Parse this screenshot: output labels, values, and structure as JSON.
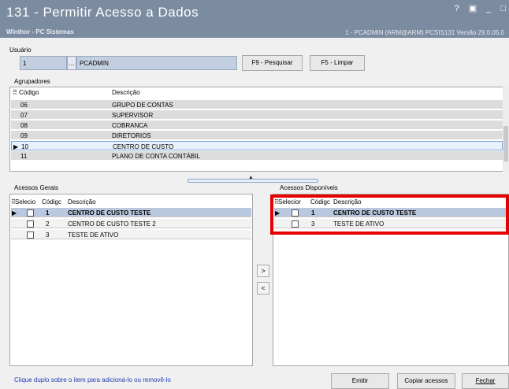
{
  "window": {
    "title": "131 - Permitir Acesso a Dados",
    "subtitle": "Winthor - PC Sistemas",
    "info": "1 - PCADMIN (ARM@ARM)  PCSIS131  Versão  29.0.05.0",
    "controls": [
      "?",
      "▣",
      "_",
      "□"
    ]
  },
  "user": {
    "label": "Usuário",
    "id": "1",
    "dots": "...",
    "name": "PCADMIN"
  },
  "buttons": {
    "search": "F9 - Pesquisar",
    "clear": "F5 - Limpar",
    "add": ">",
    "remove": "<",
    "emit": "Emitir",
    "copy": "Copiar acessos",
    "close": "Fechar"
  },
  "agrupadores": {
    "label": "Agrupadores",
    "headers": {
      "code": "Código",
      "desc": "Descrição"
    },
    "rows": [
      {
        "code": "06",
        "desc": "GRUPO DE CONTAS"
      },
      {
        "code": "07",
        "desc": "SUPERVISOR"
      },
      {
        "code": "08",
        "desc": "COBRANCA"
      },
      {
        "code": "09",
        "desc": "DIRETORIOS"
      },
      {
        "code": "10",
        "desc": "CENTRO DE CUSTO"
      },
      {
        "code": "11",
        "desc": "PLANO DE CONTA CONTÁBIL"
      }
    ]
  },
  "acessos_gerais": {
    "label": "Acessos Gerais",
    "headers": {
      "sel": "Selecio",
      "code": "Códigc",
      "desc": "Descrição"
    },
    "rows": [
      {
        "code": "1",
        "desc": "CENTRO DE CUSTO TESTE"
      },
      {
        "code": "2",
        "desc": "CENTRO DE CUSTO TESTE 2"
      },
      {
        "code": "3",
        "desc": "TESTE DE ATIVO"
      }
    ]
  },
  "acessos_disponiveis": {
    "label": "Acessos Disponíveis",
    "headers": {
      "sel": "Selecior",
      "code": "Códigc",
      "desc": "Descrição"
    },
    "rows": [
      {
        "code": "1",
        "desc": "CENTRO DE CUSTO TESTE"
      },
      {
        "code": "3",
        "desc": "TESTE DE ATIVO"
      }
    ]
  },
  "footer": {
    "hint": "Clique duplo sobre o item para adicioná-lo ou removê-lo"
  },
  "colors": {
    "titlebar": "#7b8ba0",
    "highlight_box": "#e60000",
    "hint_text": "#1f3fb3"
  }
}
